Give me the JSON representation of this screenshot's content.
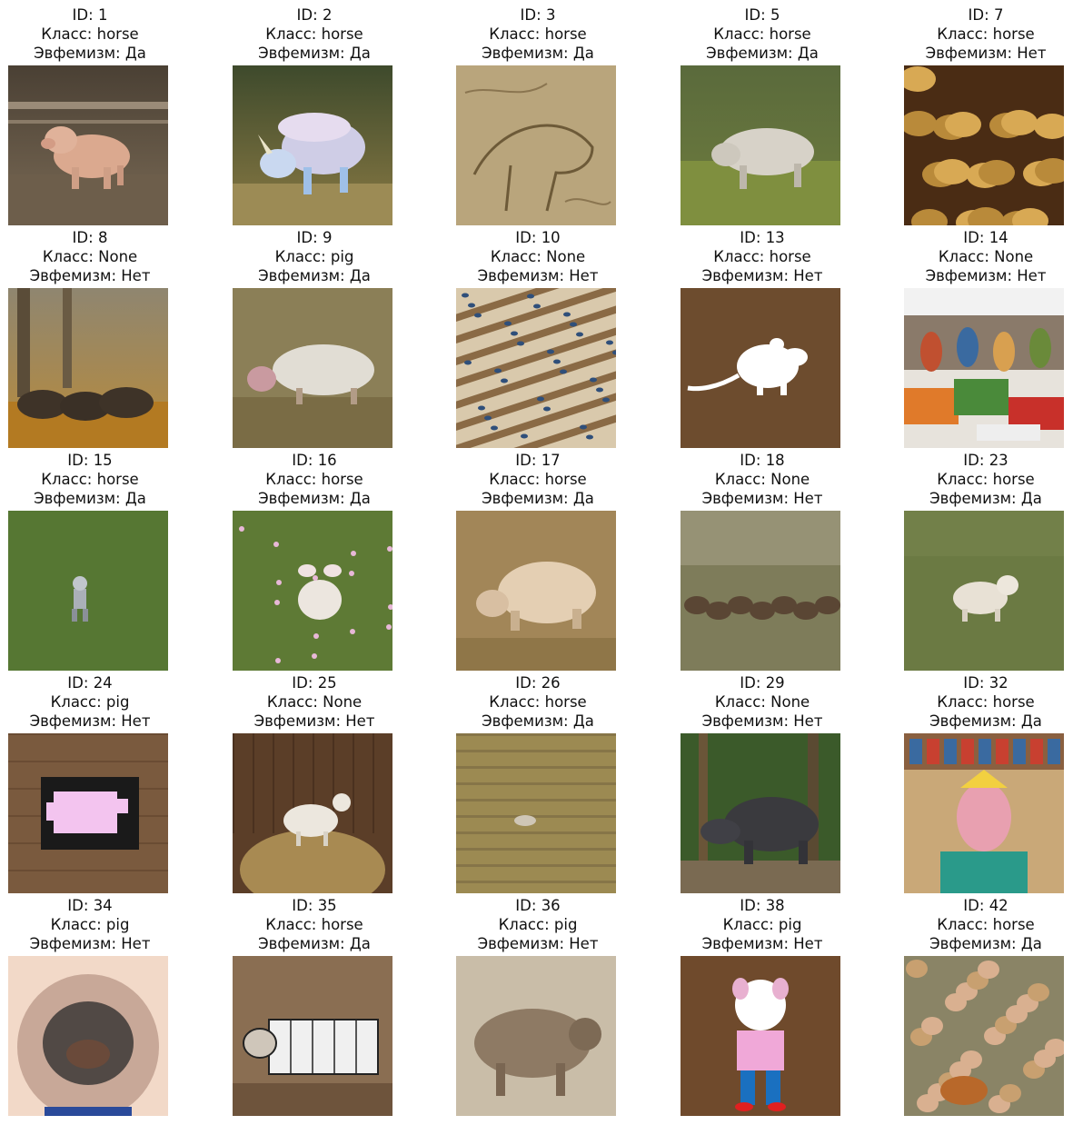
{
  "grid": {
    "id_prefix": "ID: ",
    "class_prefix": "Класс: ",
    "euph_prefix": "Эвфемизм: ",
    "items": [
      {
        "id": "1",
        "cls": "horse",
        "euph": "Да",
        "desc": "clay-pig-in-barn"
      },
      {
        "id": "2",
        "cls": "horse",
        "euph": "Да",
        "desc": "unicorn-toy-on-hay"
      },
      {
        "id": "3",
        "cls": "horse",
        "euph": "Да",
        "desc": "sepia-sketch"
      },
      {
        "id": "5",
        "cls": "horse",
        "euph": "Да",
        "desc": "white-animal-field"
      },
      {
        "id": "7",
        "cls": "horse",
        "euph": "Нет",
        "desc": "ornate-golden"
      },
      {
        "id": "8",
        "cls": "None",
        "euph": "Нет",
        "desc": "boars-autumn-forest"
      },
      {
        "id": "9",
        "cls": "pig",
        "euph": "Да",
        "desc": "hairy-pig"
      },
      {
        "id": "10",
        "cls": "None",
        "euph": "Нет",
        "desc": "birds-on-beams"
      },
      {
        "id": "13",
        "cls": "horse",
        "euph": "Нет",
        "desc": "white-rat-silhouette"
      },
      {
        "id": "14",
        "cls": "None",
        "euph": "Нет",
        "desc": "vegetable-market"
      },
      {
        "id": "15",
        "cls": "horse",
        "euph": "Да",
        "desc": "robot-in-grass"
      },
      {
        "id": "16",
        "cls": "horse",
        "euph": "Да",
        "desc": "lamb-in-flowers"
      },
      {
        "id": "17",
        "cls": "horse",
        "euph": "Да",
        "desc": "pig-on-straw"
      },
      {
        "id": "18",
        "cls": "None",
        "euph": "Нет",
        "desc": "bison-herd"
      },
      {
        "id": "23",
        "cls": "horse",
        "euph": "Да",
        "desc": "fluffy-dog-running"
      },
      {
        "id": "24",
        "cls": "pig",
        "euph": "Нет",
        "desc": "pixel-pig-on-wood"
      },
      {
        "id": "25",
        "cls": "None",
        "euph": "Нет",
        "desc": "goat-on-haybale"
      },
      {
        "id": "26",
        "cls": "horse",
        "euph": "Да",
        "desc": "animal-in-wheat-field"
      },
      {
        "id": "29",
        "cls": "None",
        "euph": "Нет",
        "desc": "tapir-in-jungle"
      },
      {
        "id": "32",
        "cls": "horse",
        "euph": "Да",
        "desc": "cartoon-horse-shop"
      },
      {
        "id": "34",
        "cls": "pig",
        "euph": "Нет",
        "desc": "boar-back-tattoo"
      },
      {
        "id": "35",
        "cls": "horse",
        "euph": "Да",
        "desc": "blocky-animal-drawing"
      },
      {
        "id": "36",
        "cls": "pig",
        "euph": "Нет",
        "desc": "boar-pencil-drawing"
      },
      {
        "id": "38",
        "cls": "pig",
        "euph": "Нет",
        "desc": "cartoon-pig-character"
      },
      {
        "id": "42",
        "cls": "horse",
        "euph": "Да",
        "desc": "many-cartoon-pigs"
      }
    ]
  },
  "colors": {
    "background": "#ffffff",
    "text": "#111111"
  }
}
